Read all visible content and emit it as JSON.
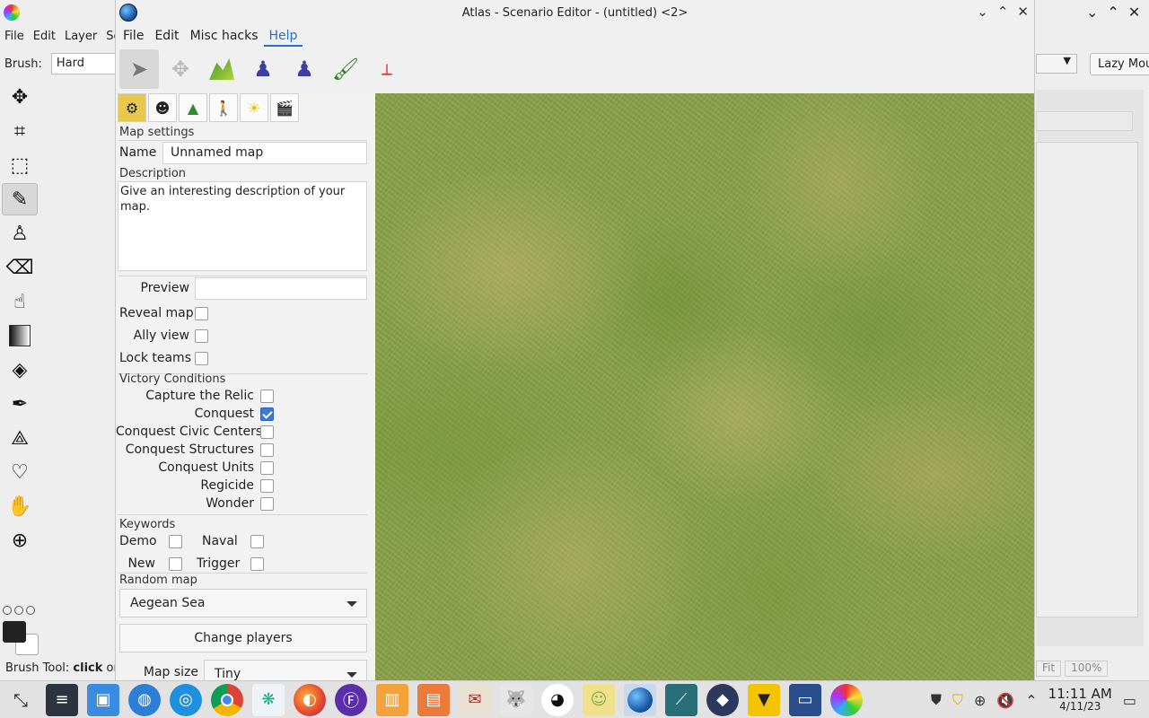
{
  "background_app": {
    "menu": [
      "File",
      "Edit",
      "Layer",
      "Se"
    ],
    "brush_label": "Brush:",
    "brush_value": "Hard",
    "lazy_button": "Lazy Mou",
    "status_prefix": "Brush Tool:",
    "status_bold": "click",
    "status_suffix": "or",
    "fit_labels": [
      "Fit",
      "100%"
    ]
  },
  "atlas": {
    "title": "Atlas - Scenario Editor - (untitled) <2>",
    "menu": [
      "File",
      "Edit",
      "Misc hacks",
      "Help"
    ],
    "active_menu": "Help",
    "map_settings": {
      "section": "Map settings",
      "name_label": "Name",
      "name_value": "Unnamed map",
      "description_label": "Description",
      "description_value": "Give an interesting description of your map.",
      "preview_label": "Preview",
      "preview_value": "",
      "reveal_map_label": "Reveal map",
      "ally_view_label": "Ally view",
      "lock_teams_label": "Lock teams"
    },
    "victory": {
      "section": "Victory Conditions",
      "items": [
        {
          "label": "Capture the Relic",
          "checked": false
        },
        {
          "label": "Conquest",
          "checked": true
        },
        {
          "label": "Conquest Civic Centers",
          "checked": false
        },
        {
          "label": "Conquest Structures",
          "checked": false
        },
        {
          "label": "Conquest Units",
          "checked": false
        },
        {
          "label": "Regicide",
          "checked": false
        },
        {
          "label": "Wonder",
          "checked": false
        }
      ]
    },
    "keywords": {
      "section": "Keywords",
      "demo": "Demo",
      "naval": "Naval",
      "new": "New",
      "trigger": "Trigger"
    },
    "random_map": {
      "section": "Random map",
      "selected": "Aegean Sea",
      "change_players": "Change players",
      "map_size_label": "Map size",
      "map_size_value": "Tiny"
    }
  },
  "taskbar": {
    "time": "11:11 AM",
    "date": "4/11/23"
  }
}
